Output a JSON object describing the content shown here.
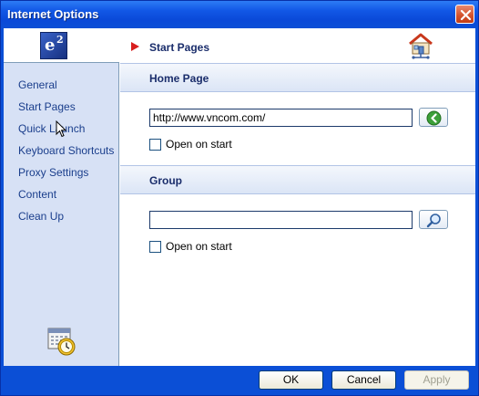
{
  "window": {
    "title": "Internet Options"
  },
  "sidebar": {
    "logo": {
      "letter": "e",
      "superscript": "2"
    },
    "items": [
      {
        "label": "General"
      },
      {
        "label": "Start Pages"
      },
      {
        "label": "Quick Launch"
      },
      {
        "label": "Keyboard Shortcuts"
      },
      {
        "label": "Proxy Settings"
      },
      {
        "label": "Content"
      },
      {
        "label": "Clean Up"
      }
    ],
    "bottom_icon": "calendar-clock-icon"
  },
  "main": {
    "title": "Start Pages",
    "header_icon": "house-network-icon",
    "home_page": {
      "heading": "Home Page",
      "url_value": "http://www.vncom.com/",
      "go_icon": "green-arrow-icon",
      "open_on_start_label": "Open on start",
      "open_on_start_checked": false
    },
    "group": {
      "heading": "Group",
      "value": "",
      "browse_icon": "magnifier-icon",
      "open_on_start_label": "Open on start",
      "open_on_start_checked": false
    }
  },
  "buttons": {
    "ok": "OK",
    "cancel": "Cancel",
    "apply": "Apply",
    "apply_enabled": false
  }
}
